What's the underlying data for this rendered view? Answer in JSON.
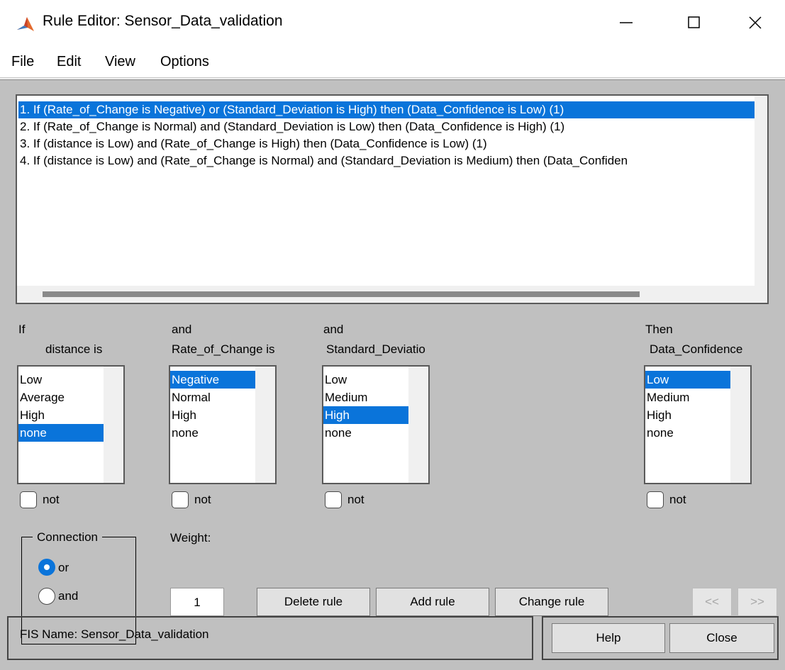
{
  "window": {
    "title": "Rule Editor: Sensor_Data_validation",
    "controls": [
      "minimize-icon",
      "maximize-icon",
      "close-icon"
    ]
  },
  "menu": [
    "File",
    "Edit",
    "View",
    "Options"
  ],
  "rules": [
    "1. If (Rate_of_Change is Negative) or (Standard_Deviation is High) then (Data_Confidence is Low) (1)",
    "2. If (Rate_of_Change is Normal) and (Standard_Deviation is Low) then (Data_Confidence is High) (1)",
    "3. If (distance is Low) and (Rate_of_Change is High) then (Data_Confidence is Low) (1)",
    "4. If (distance is Low) and (Rate_of_Change is Normal) and (Standard_Deviation is Medium) then (Data_Confiden"
  ],
  "inputs": [
    {
      "prefix": "If",
      "label": "distance is",
      "items": [
        "Low",
        "Average",
        "High",
        "none"
      ],
      "selected": 3,
      "not_label": "not"
    },
    {
      "prefix": "and",
      "label": "Rate_of_Change is",
      "items": [
        "Negative",
        "Normal",
        "High",
        "none"
      ],
      "selected": 0,
      "not_label": "not"
    },
    {
      "prefix": "and",
      "label": "Standard_Deviatio",
      "items": [
        "Low",
        "Medium",
        "High",
        "none"
      ],
      "selected": 2,
      "not_label": "not"
    }
  ],
  "output": {
    "prefix": "Then",
    "label": "Data_Confidence",
    "items": [
      "Low",
      "Medium",
      "High",
      "none"
    ],
    "selected": 0,
    "not_label": "not"
  },
  "connection": {
    "title": "Connection",
    "or_label": "or",
    "and_label": "and",
    "selected": "or"
  },
  "weight": {
    "label": "Weight:",
    "value": "1"
  },
  "buttons": {
    "delete_rule": "Delete rule",
    "add_rule": "Add rule",
    "change_rule": "Change rule",
    "prev": "<<",
    "next": ">>",
    "help": "Help",
    "close": "Close"
  },
  "status": {
    "fis_name": "FIS Name: Sensor_Data_validation"
  },
  "colors": {
    "selection": "#0a74da",
    "panel": "#c0c0c0"
  }
}
